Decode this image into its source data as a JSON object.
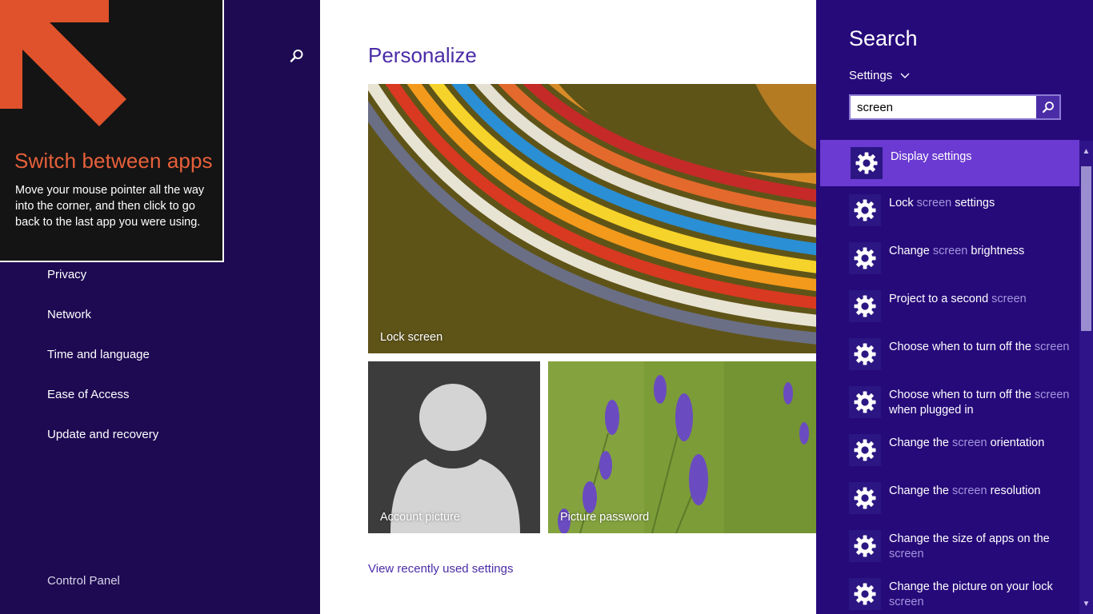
{
  "left_nav": {
    "items": [
      {
        "label": "Privacy"
      },
      {
        "label": "Network"
      },
      {
        "label": "Time and language"
      },
      {
        "label": "Ease of Access"
      },
      {
        "label": "Update and recovery"
      }
    ],
    "control_panel_label": "Control Panel",
    "search_icon": "search-icon"
  },
  "tip": {
    "title": "Switch between apps",
    "body": "Move your mouse pointer all the way into the corner, and then click to go back to the last app you were using.",
    "arrow_icon": "up-left-arrow-icon",
    "title_color": "#e8603a"
  },
  "main": {
    "title": "Personalize",
    "tiles": [
      {
        "label": "Lock screen"
      },
      {
        "label": "Account picture"
      },
      {
        "label": "Picture password"
      }
    ],
    "recent_link": "View recently used settings"
  },
  "search_pane": {
    "heading": "Search",
    "scope": "Settings",
    "query": "screen",
    "results": [
      {
        "parts": [
          "Display settings"
        ],
        "selected": true
      },
      {
        "parts": [
          "Lock ",
          "screen",
          " settings"
        ]
      },
      {
        "parts": [
          "Change ",
          "screen",
          " brightness"
        ]
      },
      {
        "parts": [
          "Project to a second ",
          "screen"
        ]
      },
      {
        "parts": [
          "Choose when to turn off the ",
          "screen"
        ]
      },
      {
        "parts": [
          "Choose when to turn off the ",
          "screen",
          " when plugged in"
        ]
      },
      {
        "parts": [
          "Change the ",
          "screen",
          " orientation"
        ]
      },
      {
        "parts": [
          "Change the ",
          "screen",
          " resolution"
        ]
      },
      {
        "parts": [
          "Change the size of apps on the ",
          "screen"
        ]
      },
      {
        "parts": [
          "Change the picture on your lock ",
          "screen"
        ]
      }
    ],
    "result_icon": "gear-icon"
  },
  "colors": {
    "nav_bg": "#1d0a52",
    "search_bg": "#260a7a",
    "accent": "#4b2ca7",
    "selected": "#6b3ad2",
    "highlight_text": "#a596df"
  }
}
